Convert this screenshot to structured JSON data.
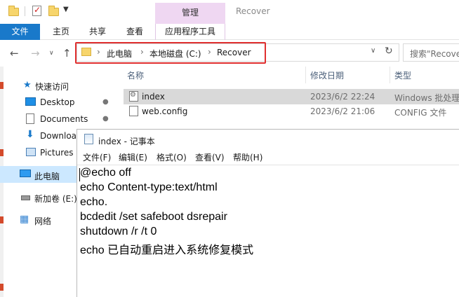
{
  "titlebar": {
    "manage_tab": "管理",
    "window_title": "Recover"
  },
  "ribbon": {
    "tabs": [
      "文件",
      "主页",
      "共享",
      "查看"
    ],
    "app_tools": "应用程序工具"
  },
  "address": {
    "crumbs": [
      "此电脑",
      "本地磁盘 (C:)",
      "Recover"
    ],
    "search_placeholder": "搜索\"Recover\""
  },
  "columns": [
    "名称",
    "修改日期",
    "类型"
  ],
  "sidebar": {
    "quick_access": "快速访问",
    "items": [
      "Desktop",
      "Documents",
      "Downloads",
      "Pictures"
    ],
    "this_pc": "此电脑",
    "new_volume": "新加卷 (E:)",
    "network": "网络"
  },
  "files": [
    {
      "name": "index",
      "date": "2023/6/2 22:24",
      "type": "Windows 批处理文件"
    },
    {
      "name": "web.config",
      "date": "2023/6/2 21:06",
      "type": "CONFIG 文件"
    }
  ],
  "notepad": {
    "title": "index - 记事本",
    "menu": [
      "文件(F)",
      "编辑(E)",
      "格式(O)",
      "查看(V)",
      "帮助(H)"
    ],
    "lines": [
      "@echo off",
      "echo Content-type:text/html",
      "echo.",
      "bcdedit /set safeboot dsrepair",
      "shutdown /r /t 0",
      "echo 已自动重启进入系统修复模式"
    ]
  },
  "colors": {
    "file_tab": "#1979ca",
    "manage_tab": "#efd7f2",
    "highlight_border": "#e02f2f",
    "selection": "#cce8ff"
  }
}
